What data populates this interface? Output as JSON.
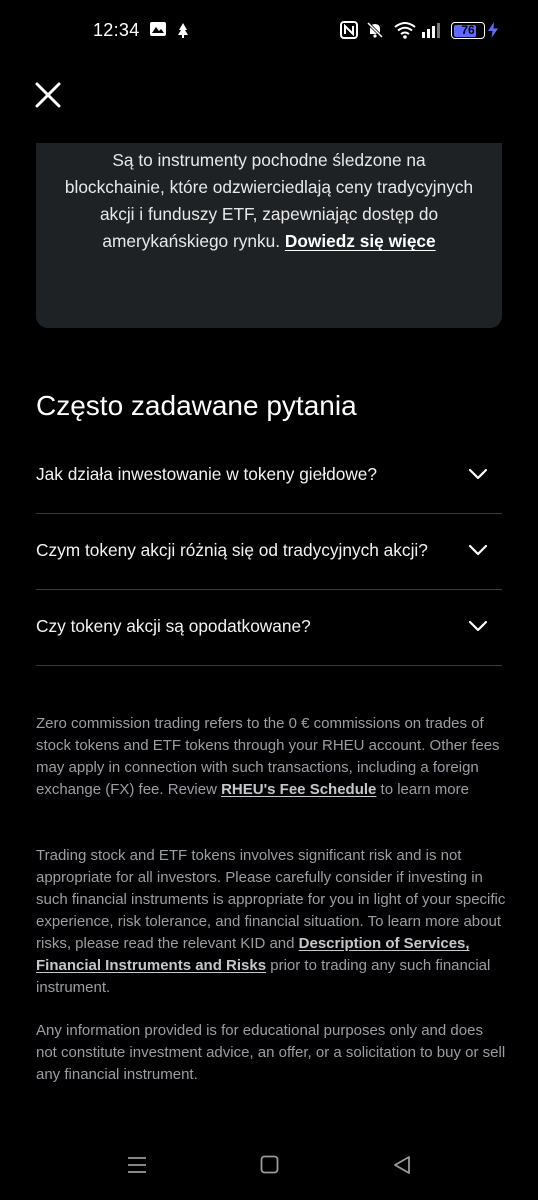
{
  "status_bar": {
    "time": "12:34",
    "battery": "76",
    "battery_level": 0.76,
    "accent_color": "#5f6bff"
  },
  "close_icon": "close-icon",
  "info_card": {
    "text": "Są to instrumenty pochodne śledzone na blockchainie, które odzwierciedlają ceny tradycyjnych akcji i funduszy ETF, zapewniając dostęp do amerykańskiego rynku.",
    "link_label": "Dowiedz się więce"
  },
  "faq": {
    "title": "Często zadawane pytania",
    "items": [
      {
        "question": "Jak działa inwestowanie w tokeny giełdowe?"
      },
      {
        "question": "Czym tokeny akcji różnią się od tradycyjnych akcji?"
      },
      {
        "question": "Czy tokeny akcji są opodatkowane?"
      }
    ]
  },
  "disclaimers": {
    "p1_text": "Zero commission trading refers to the 0 € commissions on trades of stock tokens and ETF tokens through your RHEU account. Other fees may apply in connection with such transactions, including a foreign exchange (FX) fee. Review",
    "p1_link": "RHEU's Fee Schedule",
    "p1_after": "to learn more",
    "p2_text": "Trading stock and ETF tokens involves significant risk and is not appropriate for all investors. Please carefully consider if investing in such financial instruments is appropriate for you in light of your specific experience, risk tolerance, and financial situation. To learn more about risks, please read the relevant KID and",
    "p2_link": "Description of Services, Financial Instruments and Risks",
    "p2_after": "prior to trading any such financial instrument.",
    "p3_text": "Any information provided is for educational purposes only and does not constitute investment advice, an offer, or a solicitation to buy or sell any financial instrument."
  },
  "nav_bar": {
    "icons": [
      "menu-icon",
      "home-square-icon",
      "back-triangle-icon"
    ]
  }
}
